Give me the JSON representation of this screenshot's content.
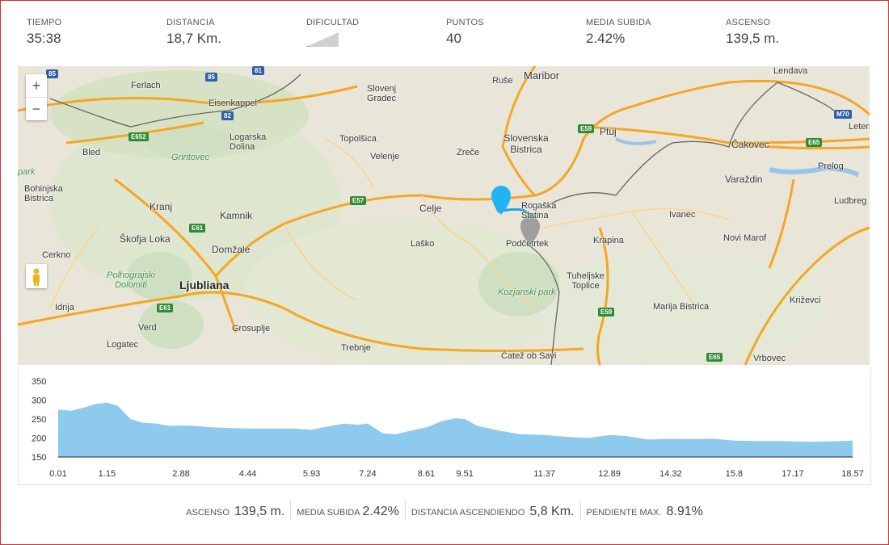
{
  "top_stats": [
    {
      "label": "TIEMPO",
      "value": "35:38"
    },
    {
      "label": "DISTANCIA",
      "value": "18,7 Km."
    },
    {
      "label": "DIFICULTAD",
      "value": ""
    },
    {
      "label": "PUNTOS",
      "value": "40"
    },
    {
      "label": "MEDIA SUBIDA",
      "value": "2.42%"
    },
    {
      "label": "ASCENSO",
      "value": "139,5 m."
    }
  ],
  "difficulty_level": 0.1,
  "map": {
    "zoom_in": "+",
    "zoom_out": "−",
    "places": {
      "maribor": "Maribor",
      "ruse": "Ruše",
      "lendava": "Lendava",
      "ferlach": "Ferlach",
      "eisenkappel": "Eisenkappel",
      "slovenj_gradec": "Slovenj Gradec",
      "logarska": "Logarska Dolina",
      "topolsica": "Topolšica",
      "velenje": "Velenje",
      "zrece": "Zreče",
      "slov_bistrica": "Slovenska Bistrica",
      "ptuj": "Ptuj",
      "cakovec": "Čakovec",
      "prelog": "Prelog",
      "letenye": "Leten",
      "bled": "Bled",
      "grintovec": "Grintovec",
      "bohinjska": "Bohinjska Bistrica",
      "park": "park",
      "kranj": "Kranj",
      "kamnik": "Kamnik",
      "celje": "Celje",
      "rogaska": "Rogaška Slatina",
      "varazdin": "Varaždin",
      "ludbreg": "Ludbreg",
      "ivanec": "Ivanec",
      "skofja": "Škofja Loka",
      "lasko": "Laško",
      "podcetrtek": "Podčetrtek",
      "krapina": "Krapina",
      "novi_marof": "Novi Marof",
      "cerkno": "Cerkno",
      "domzale": "Domžale",
      "polhograjski": "Polhograjski Dolomiti",
      "ljubljana": "Ljubliana",
      "tuheljske": "Tuheljske Toplice",
      "kozjanski": "Kozjanski park",
      "idrija": "Idrija",
      "marija": "Marija Bistrica",
      "krizevci": "Križevci",
      "verd": "Verd",
      "grosuplje": "Grosuplje",
      "logatec": "Logatec",
      "trebnje": "Trebnje",
      "catez": "Čatež ob Savi",
      "vrbovec": "Vrbovec"
    },
    "shields": {
      "s85a": "85",
      "s81": "81",
      "s85b": "85",
      "s82": "82",
      "e652": "E652",
      "e57": "E57",
      "e59a": "E59",
      "e61a": "E61",
      "e61b": "E61",
      "e59b": "E59",
      "e65a": "E65",
      "e65b": "E65",
      "m70": "M70"
    }
  },
  "chart_data": {
    "type": "area",
    "x": [
      0.01,
      0.3,
      0.6,
      0.9,
      1.15,
      1.4,
      1.7,
      2.0,
      2.3,
      2.6,
      2.88,
      3.2,
      3.6,
      4.0,
      4.44,
      5.0,
      5.5,
      5.93,
      6.3,
      6.7,
      7.0,
      7.24,
      7.6,
      7.9,
      8.2,
      8.61,
      9.0,
      9.3,
      9.51,
      9.8,
      10.3,
      10.8,
      11.37,
      11.9,
      12.4,
      12.89,
      13.3,
      13.8,
      14.32,
      14.8,
      15.3,
      15.8,
      16.3,
      16.8,
      17.17,
      17.6,
      18.0,
      18.3,
      18.57
    ],
    "y": [
      275,
      272,
      280,
      290,
      293,
      285,
      250,
      240,
      238,
      232,
      233,
      232,
      228,
      226,
      225,
      225,
      225,
      222,
      230,
      238,
      235,
      238,
      212,
      210,
      218,
      228,
      245,
      252,
      250,
      232,
      220,
      210,
      208,
      203,
      200,
      208,
      205,
      196,
      198,
      197,
      198,
      193,
      192,
      192,
      191,
      190,
      191,
      192,
      193
    ],
    "x_ticks": [
      "0.01",
      "1.15",
      "2.88",
      "4.44",
      "5.93",
      "7.24",
      "8.61",
      "9.51",
      "11.37",
      "12.89",
      "14.32",
      "15.8",
      "17.17",
      "18.57"
    ],
    "x_tick_values": [
      0.01,
      1.15,
      2.88,
      4.44,
      5.93,
      7.24,
      8.61,
      9.51,
      11.37,
      12.89,
      14.32,
      15.8,
      17.17,
      18.57
    ],
    "y_ticks": [
      "350",
      "300",
      "250",
      "200",
      "150"
    ],
    "y_tick_values": [
      350,
      300,
      250,
      200,
      150
    ],
    "ylim": [
      150,
      350
    ],
    "xlim": [
      0.01,
      18.57
    ],
    "fill_color": "#8ec9ee",
    "grid": false
  },
  "bottom_stats": [
    {
      "label": "ASCENSO",
      "value": "139,5 m."
    },
    {
      "label": "MEDIA SUBIDA",
      "value": "2.42%"
    },
    {
      "label": "DISTANCIA ASCENDIENDO",
      "value": "5,8 Km."
    },
    {
      "label": "PENDIENTE MAX.",
      "value": "8.91%"
    }
  ],
  "colors": {
    "route": "#1fa3e8",
    "start_marker": "#1fb5f0",
    "end_marker": "#9e9e9e",
    "frame": "#d32f2f",
    "highway": "#f5a623"
  }
}
